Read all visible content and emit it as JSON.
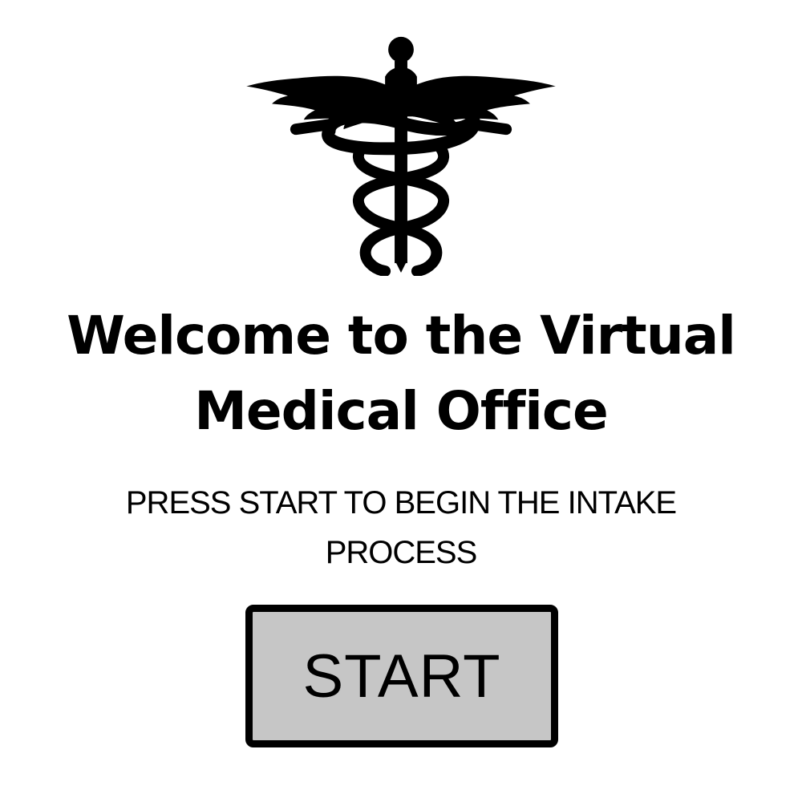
{
  "logo": {
    "icon": "caduceus-icon",
    "color": "#000000"
  },
  "welcome": {
    "title": "Welcome to the Virtual Medical Office",
    "instruction": "PRESS START TO BEGIN THE INTAKE PROCESS"
  },
  "start_button": {
    "label": "START",
    "background": "#c6c6c6",
    "border_color": "#000000"
  }
}
